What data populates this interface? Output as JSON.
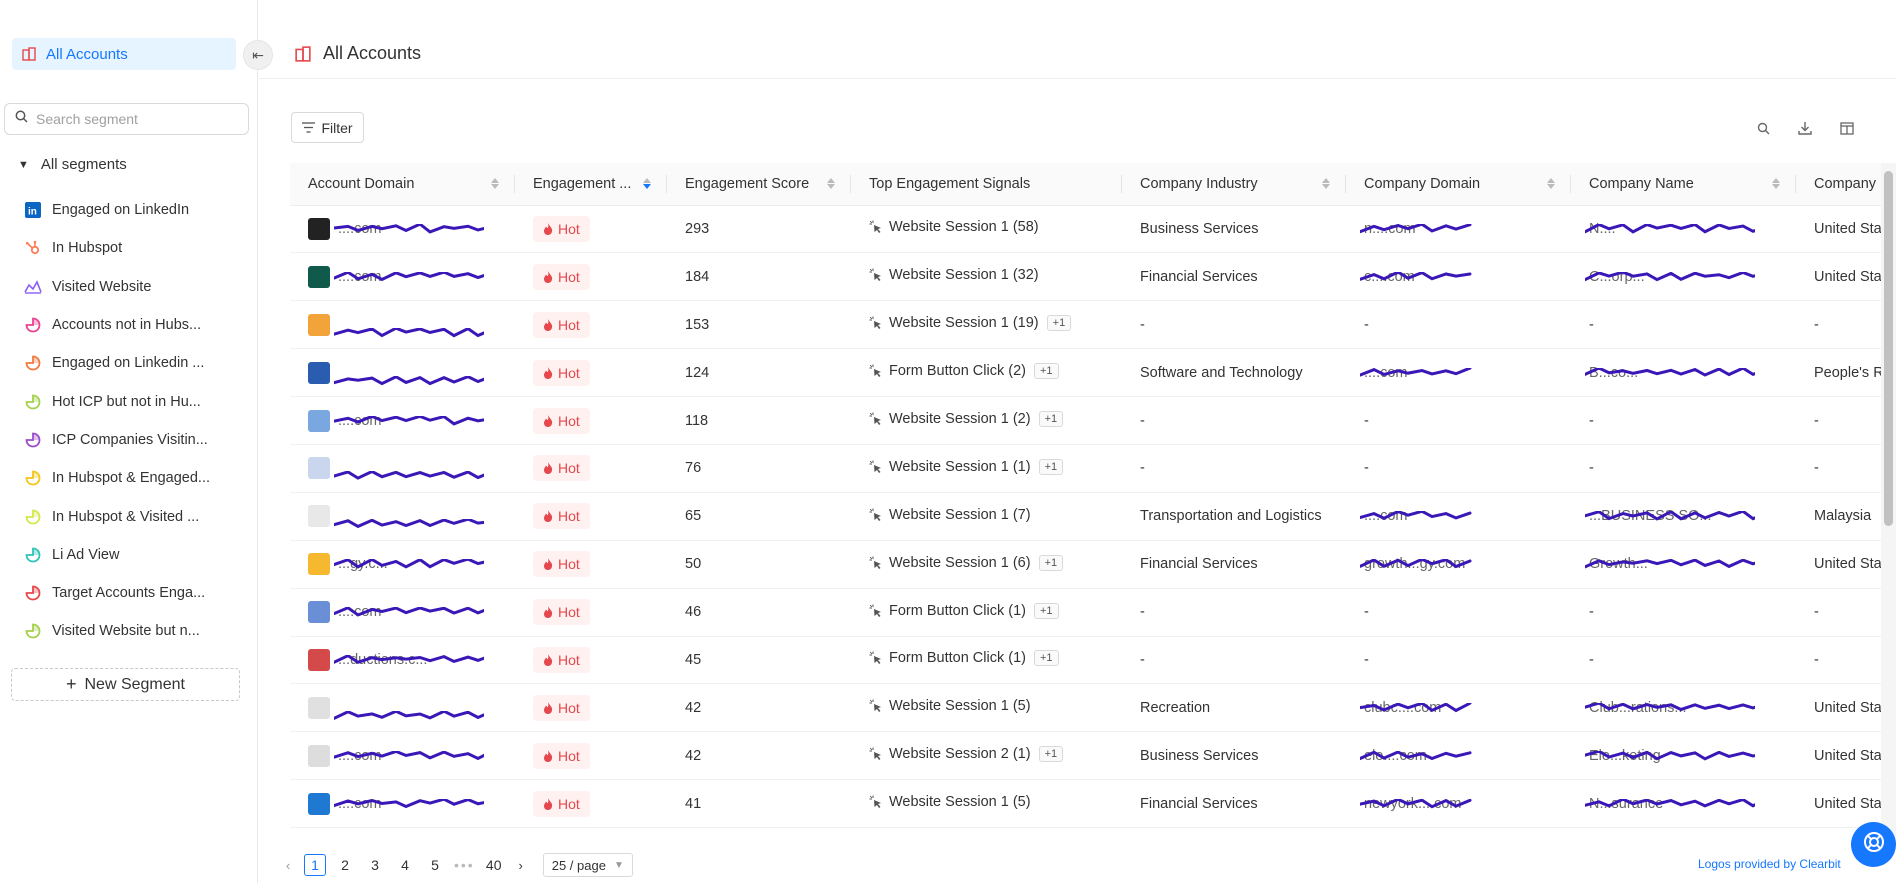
{
  "sidebar": {
    "top_item": "All Accounts",
    "search_placeholder": "Search segment",
    "segments_header": "All segments",
    "items": [
      {
        "label": "Engaged on LinkedIn",
        "icon": "linkedin-icon",
        "color": "#0a66c2"
      },
      {
        "label": "In Hubspot",
        "icon": "hubspot-icon",
        "color": "#ff7a59"
      },
      {
        "label": "Visited Website",
        "icon": "website-icon",
        "color": "#8b5cf6"
      },
      {
        "label": "Accounts not in Hubs...",
        "icon": "pie-icon",
        "color": "#e84393"
      },
      {
        "label": "Engaged on Linkedin ...",
        "icon": "pie-icon",
        "color": "#f07b3f"
      },
      {
        "label": "Hot ICP but not in Hu...",
        "icon": "pie-icon",
        "color": "#a3d14a"
      },
      {
        "label": "ICP Companies Visitin...",
        "icon": "pie-icon",
        "color": "#9b4dca"
      },
      {
        "label": "In Hubspot & Engaged...",
        "icon": "pie-icon",
        "color": "#f5c518"
      },
      {
        "label": "In Hubspot & Visited ...",
        "icon": "pie-icon",
        "color": "#d4e84a"
      },
      {
        "label": "Li Ad View",
        "icon": "pie-icon",
        "color": "#2ec4b6"
      },
      {
        "label": "Target Accounts Enga...",
        "icon": "pie-icon",
        "color": "#e5484d"
      },
      {
        "label": "Visited Website but n...",
        "icon": "pie-icon",
        "color": "#a3d14a"
      }
    ],
    "new_segment": "New Segment"
  },
  "header": {
    "title": "All Accounts"
  },
  "toolbar": {
    "filter_label": "Filter"
  },
  "table": {
    "columns": [
      "Account Domain",
      "Engagement ...",
      "Engagement Score",
      "Top Engagement Signals",
      "Company Industry",
      "Company Domain",
      "Company Name",
      "Company"
    ],
    "rows": [
      {
        "domain": "....com",
        "logo": "#222222",
        "engagement": "Hot",
        "score": "293",
        "signal": "Website Session 1 (58)",
        "extra": "",
        "industry": "Business Services",
        "company_domain": "n....com",
        "company_name": "N....",
        "country": "United Sta"
      },
      {
        "domain": "....com",
        "logo": "#0f5a4a",
        "engagement": "Hot",
        "score": "184",
        "signal": "Website Session 1 (32)",
        "extra": "",
        "industry": "Financial Services",
        "company_domain": "c....com",
        "company_name": "C...orp...",
        "country": "United Sta"
      },
      {
        "domain": "",
        "logo": "#f2a33a",
        "engagement": "Hot",
        "score": "153",
        "signal": "Website Session 1 (19)",
        "extra": "+1",
        "industry": "-",
        "company_domain": "-",
        "company_name": "-",
        "country": "-"
      },
      {
        "domain": "",
        "logo": "#2a5db0",
        "engagement": "Hot",
        "score": "124",
        "signal": "Form Button Click (2)",
        "extra": "+1",
        "industry": "Software and Technology",
        "company_domain": "....com",
        "company_name": "B...co...",
        "country": "People's R"
      },
      {
        "domain": "....com",
        "logo": "#7aa7e0",
        "engagement": "Hot",
        "score": "118",
        "signal": "Website Session 1 (2)",
        "extra": "+1",
        "industry": "-",
        "company_domain": "-",
        "company_name": "-",
        "country": "-"
      },
      {
        "domain": "",
        "logo": "#c9d6ee",
        "engagement": "Hot",
        "score": "76",
        "signal": "Website Session 1 (1)",
        "extra": "+1",
        "industry": "-",
        "company_domain": "-",
        "company_name": "-",
        "country": "-"
      },
      {
        "domain": "",
        "logo": "#e8e8e8",
        "engagement": "Hot",
        "score": "65",
        "signal": "Website Session 1 (7)",
        "extra": "",
        "industry": "Transportation and Logistics",
        "company_domain": "....com",
        "company_name": "...BUSINESS SO...",
        "country": "Malaysia"
      },
      {
        "domain": "...gy.c...",
        "logo": "#f5b82e",
        "engagement": "Hot",
        "score": "50",
        "signal": "Website Session 1 (6)",
        "extra": "+1",
        "industry": "Financial Services",
        "company_domain": "growth...gy.com",
        "company_name": "Growth...",
        "country": "United Sta"
      },
      {
        "domain": "....com",
        "logo": "#6a8fd6",
        "engagement": "Hot",
        "score": "46",
        "signal": "Form Button Click (1)",
        "extra": "+1",
        "industry": "-",
        "company_domain": "-",
        "company_name": "-",
        "country": "-"
      },
      {
        "domain": "...ductions.c...",
        "logo": "#d44a4a",
        "engagement": "Hot",
        "score": "45",
        "signal": "Form Button Click (1)",
        "extra": "+1",
        "industry": "-",
        "company_domain": "-",
        "company_name": "-",
        "country": "-"
      },
      {
        "domain": "",
        "logo": "#e0e0e0",
        "engagement": "Hot",
        "score": "42",
        "signal": "Website Session 1 (5)",
        "extra": "",
        "industry": "Recreation",
        "company_domain": "clubc....com",
        "company_name": "Club...rations...",
        "country": "United Sta"
      },
      {
        "domain": "....com",
        "logo": "#dddddd",
        "engagement": "Hot",
        "score": "42",
        "signal": "Website Session 2 (1)",
        "extra": "+1",
        "industry": "Business Services",
        "company_domain": "ele....com",
        "company_name": "Ele...keting",
        "country": "United Sta"
      },
      {
        "domain": "....com",
        "logo": "#1f78d1",
        "engagement": "Hot",
        "score": "41",
        "signal": "Website Session 1 (5)",
        "extra": "",
        "industry": "Financial Services",
        "company_domain": "newyork....com",
        "company_name": "N...surance",
        "country": "United Sta"
      }
    ]
  },
  "pagination": {
    "pages": [
      "1",
      "2",
      "3",
      "4",
      "5"
    ],
    "dots": "•••",
    "last_page": "40",
    "active": "1",
    "page_size": "25 / page"
  },
  "footer": {
    "logos_credit": "Logos provided by Clearbit"
  }
}
